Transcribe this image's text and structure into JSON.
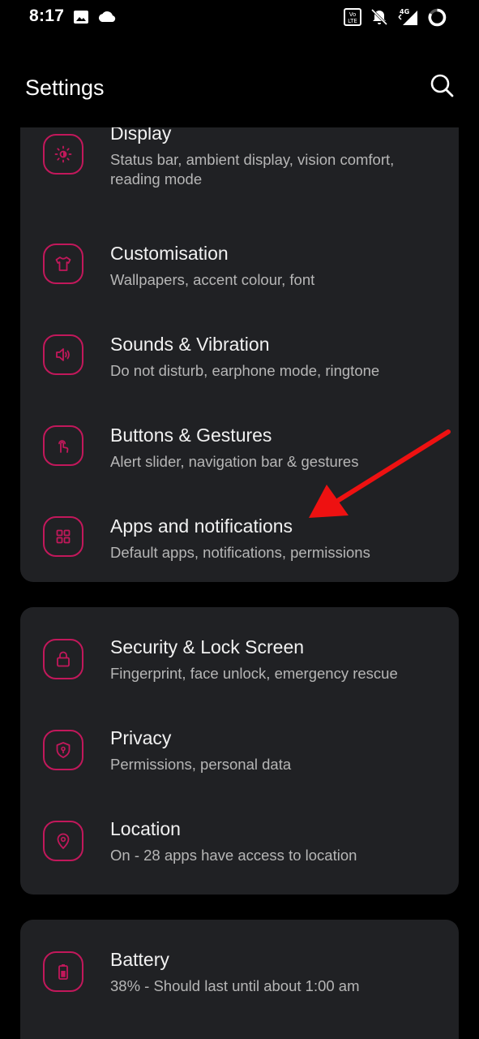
{
  "status_bar": {
    "time": "8:17",
    "icons": [
      "image-icon",
      "cloud-icon",
      "volte-icon",
      "notifications-off-icon",
      "signal-4g-icon",
      "battery-ring-icon"
    ]
  },
  "header": {
    "title": "Settings",
    "search_icon": "search-icon"
  },
  "groups": [
    {
      "items": [
        {
          "title": "Display",
          "subtitle": "Status bar, ambient display, vision comfort, reading mode",
          "icon": "display-brightness-icon"
        },
        {
          "title": "Customisation",
          "subtitle": "Wallpapers, accent colour, font",
          "icon": "tshirt-icon"
        },
        {
          "title": "Sounds & Vibration",
          "subtitle": "Do not disturb, earphone mode, ringtone",
          "icon": "speaker-icon"
        },
        {
          "title": "Buttons & Gestures",
          "subtitle": "Alert slider, navigation bar & gestures",
          "icon": "touch-gesture-icon"
        },
        {
          "title": "Apps and notifications",
          "subtitle": "Default apps, notifications, permissions",
          "icon": "apps-grid-icon"
        }
      ]
    },
    {
      "items": [
        {
          "title": "Security & Lock Screen",
          "subtitle": "Fingerprint, face unlock, emergency rescue",
          "icon": "lock-icon"
        },
        {
          "title": "Privacy",
          "subtitle": "Permissions, personal data",
          "icon": "shield-icon"
        },
        {
          "title": "Location",
          "subtitle": "On - 28 apps have access to location",
          "icon": "location-pin-icon"
        }
      ]
    },
    {
      "items": [
        {
          "title": "Battery",
          "subtitle": "38% - Should last until about 1:00 am",
          "icon": "battery-icon"
        }
      ]
    }
  ],
  "annotation": {
    "type": "arrow",
    "color": "#ee1111",
    "points_to": "Apps and notifications"
  },
  "colors": {
    "accent": "#c2185b",
    "card": "#202124",
    "background": "#000000",
    "arrow": "#ee1111"
  }
}
